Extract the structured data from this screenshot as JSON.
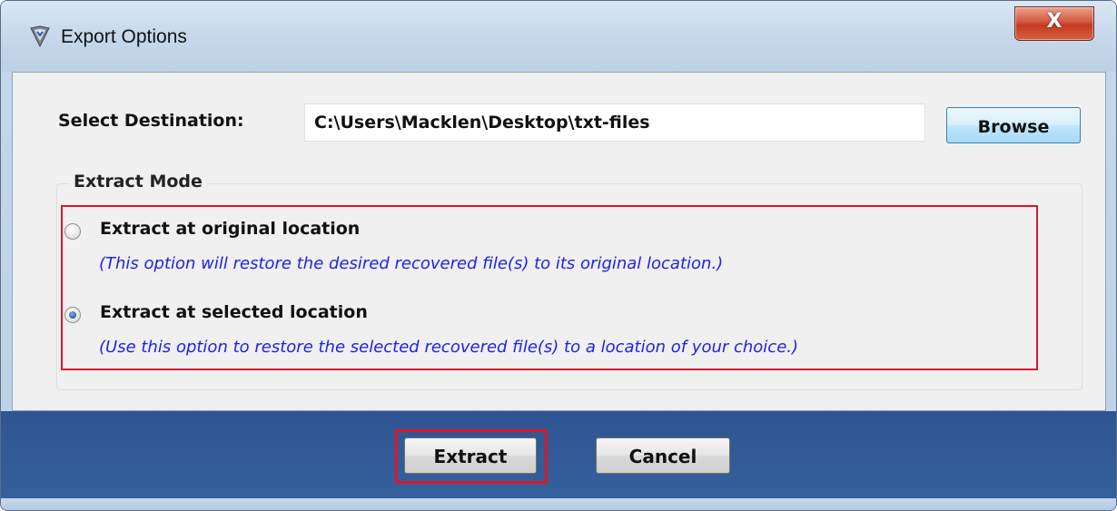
{
  "window": {
    "title": "Export Options",
    "close_label": "X"
  },
  "destination": {
    "label": "Select Destination:",
    "value": "C:\\Users\\Macklen\\Desktop\\txt-files",
    "browse_label": "Browse"
  },
  "extract_mode": {
    "legend": "Extract Mode",
    "options": [
      {
        "label": "Extract at original location",
        "description": "(This option will restore the desired recovered file(s) to its original location.)",
        "selected": false
      },
      {
        "label": "Extract at selected location",
        "description": "(Use this option to restore the selected recovered file(s) to a location of your choice.)",
        "selected": true
      }
    ]
  },
  "footer": {
    "extract_label": "Extract",
    "cancel_label": "Cancel"
  },
  "colors": {
    "description_text": "#2020ee",
    "highlight": "#d9182c",
    "footer_background": "#2e5592"
  },
  "icons": {
    "app": "shield-app-icon"
  }
}
